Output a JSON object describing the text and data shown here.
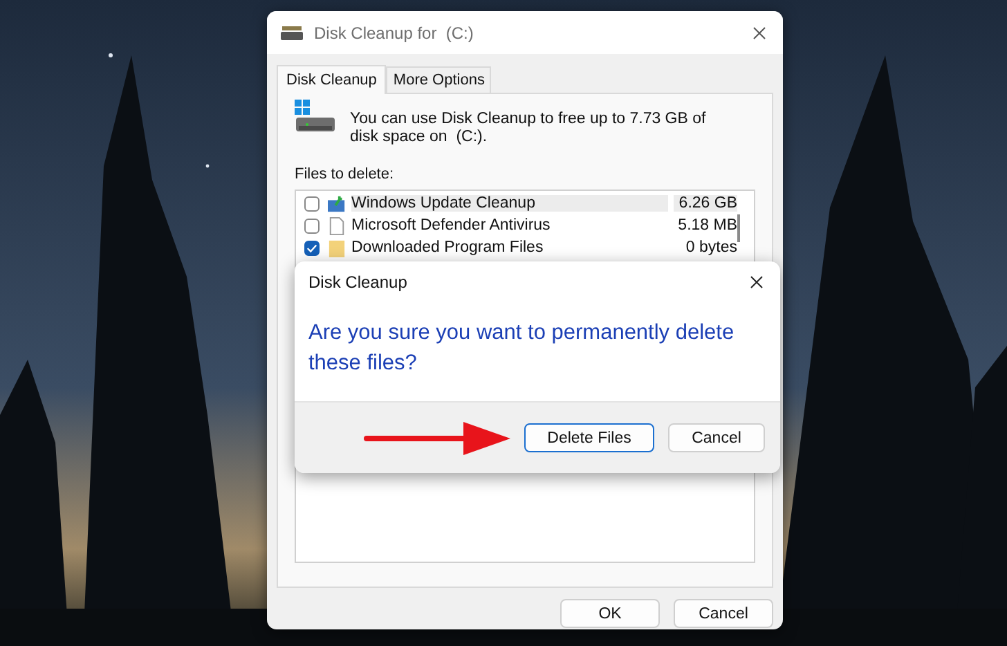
{
  "window": {
    "title": "Disk Cleanup for  (C:)"
  },
  "tabs": [
    {
      "label": "Disk Cleanup",
      "selected": true
    },
    {
      "label": "More Options",
      "selected": false
    }
  ],
  "summary": "You can use Disk Cleanup to free up to 7.73 GB of disk space on  (C:).",
  "files_label": "Files to delete:",
  "files": [
    {
      "name": "Windows Update Cleanup",
      "size": "6.26 GB",
      "checked": false,
      "selected": true
    },
    {
      "name": "Microsoft Defender Antivirus",
      "size": "5.18 MB",
      "checked": false,
      "selected": false
    },
    {
      "name": "Downloaded Program Files",
      "size": "0 bytes",
      "checked": true,
      "selected": false
    }
  ],
  "buttons": [
    "OK",
    "Cancel"
  ],
  "dialog": {
    "title": "Disk Cleanup",
    "message": "Are you sure you want to permanently delete these files?",
    "buttons": [
      "Delete Files",
      "Cancel"
    ]
  }
}
